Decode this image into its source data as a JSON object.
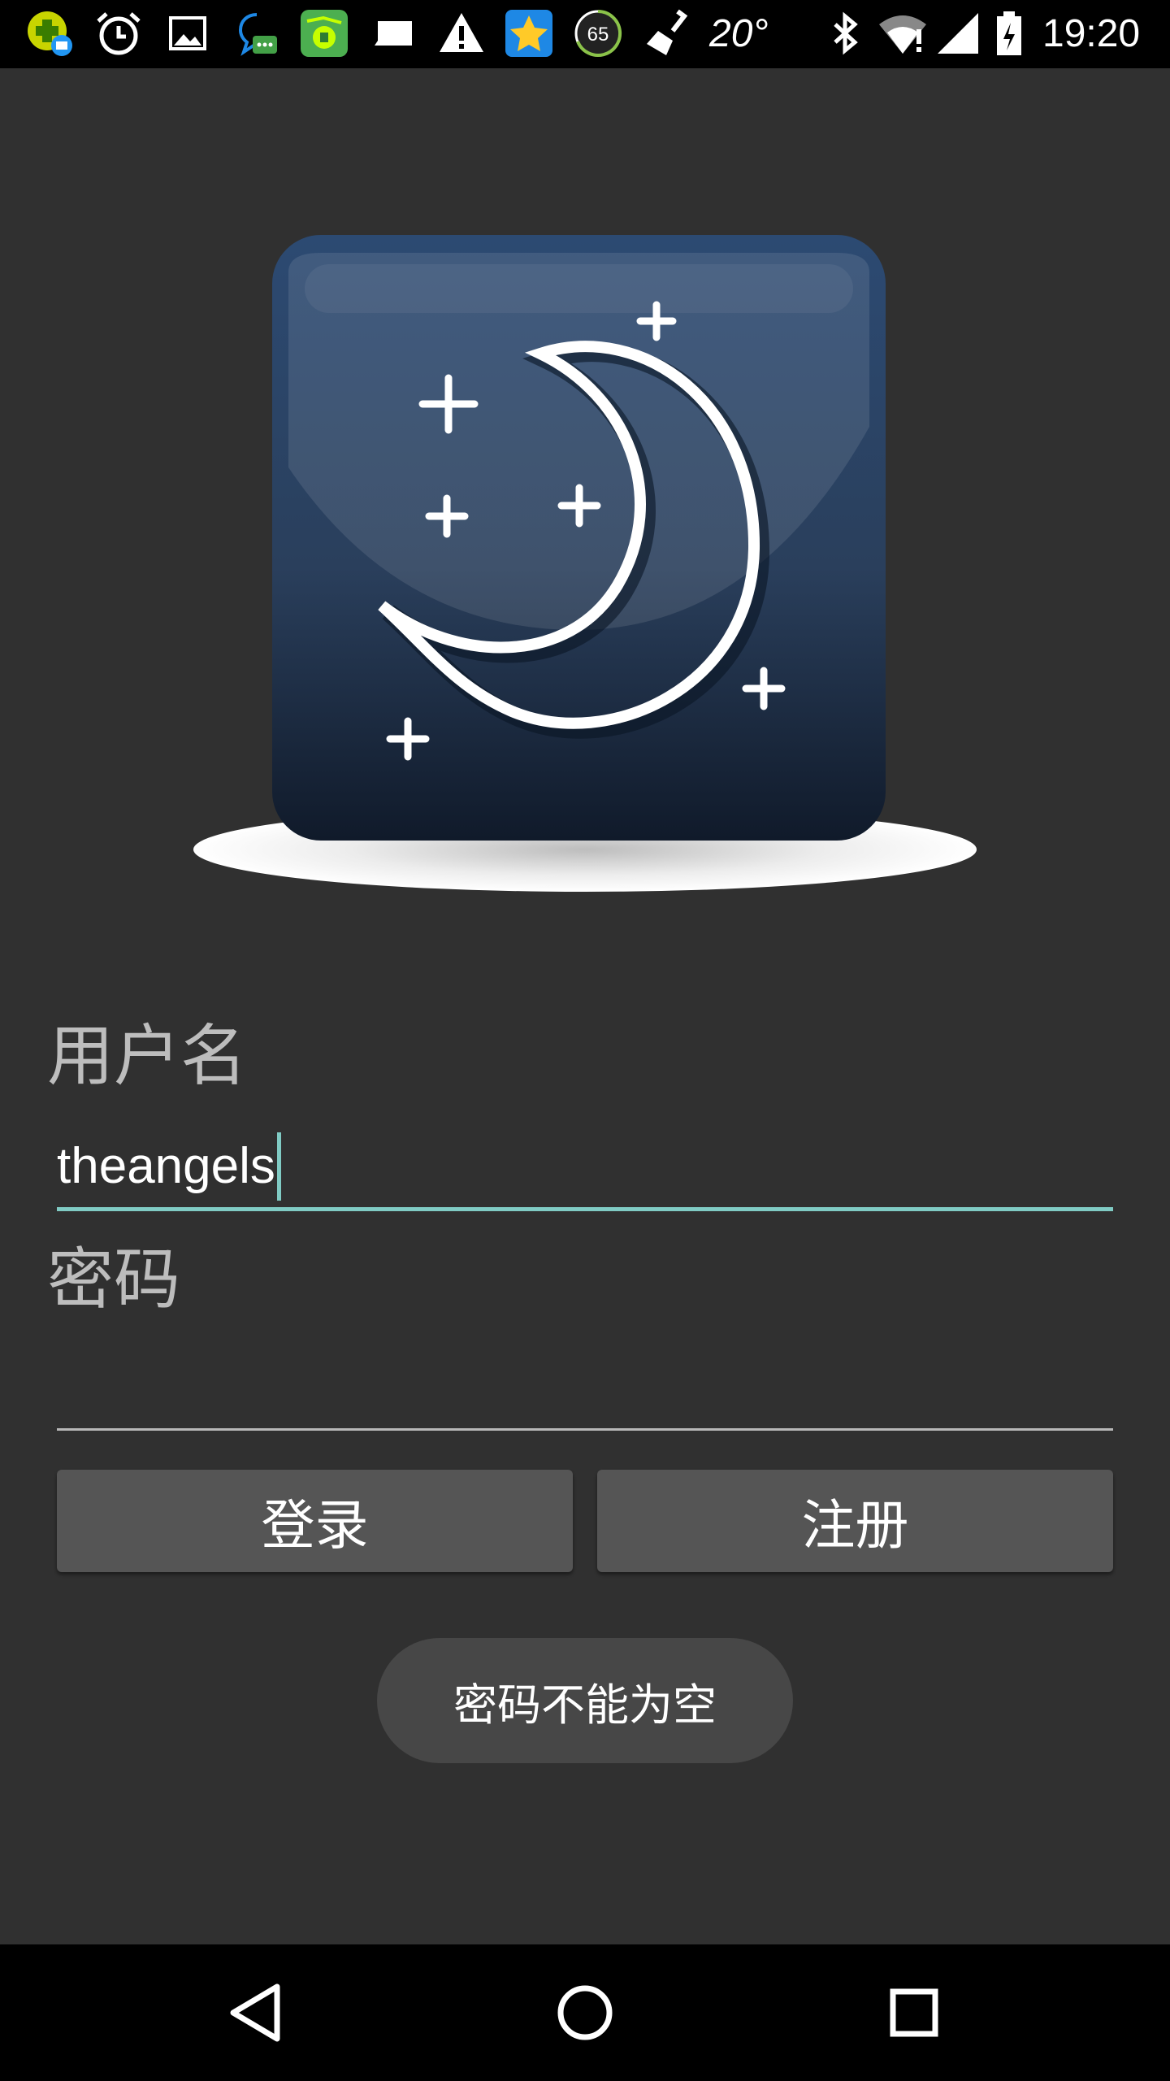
{
  "status_bar": {
    "notification_icons": [
      "app-badge-icon",
      "alarm-clock-icon",
      "image-icon",
      "chat-bubble-icon",
      "green-app-icon",
      "rectangle-message-icon",
      "warning-icon",
      "star-app-icon",
      "circle-65-icon",
      "broom-icon"
    ],
    "badge_number": "65",
    "temperature": "20°",
    "system_icons": [
      "bluetooth-icon",
      "wifi-icon",
      "signal-icon",
      "battery-icon"
    ],
    "time": "19:20"
  },
  "logo": {
    "icon": "crescent-moon-stars-icon"
  },
  "form": {
    "username_label": "用户名",
    "username_value": "theangels",
    "password_label": "密码",
    "password_value": ""
  },
  "buttons": {
    "login_label": "登录",
    "register_label": "注册"
  },
  "toast": {
    "message": "密码不能为空"
  },
  "colors": {
    "background": "#303030",
    "accent": "#80cbc4",
    "button": "#555555",
    "toast": "#474747"
  },
  "nav_bar": {
    "icons": [
      "back-icon",
      "home-icon",
      "recents-icon"
    ]
  }
}
